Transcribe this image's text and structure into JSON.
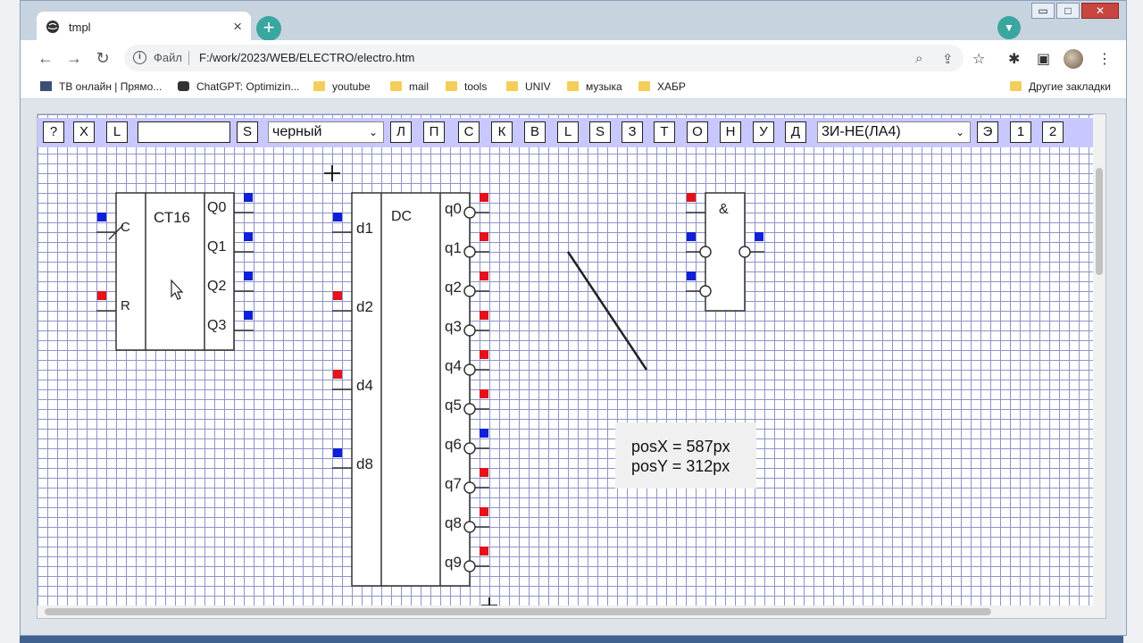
{
  "browser": {
    "tab_title": "tmpl",
    "tab_close": "×",
    "new_tab": "+",
    "omnibox_file": "Файл",
    "url": "F:/work/2023/WEB/ELECTRO/electro.htm",
    "window_controls": [
      "▭",
      "□",
      "✕"
    ]
  },
  "bookmarks": [
    {
      "label": "ТВ онлайн | Прямо...",
      "icon": "tv-icon"
    },
    {
      "label": "ChatGPT: Optimizin...",
      "icon": "chatgpt-icon"
    },
    {
      "label": "youtube",
      "icon": "folder-icon"
    },
    {
      "label": "mail",
      "icon": "folder-icon"
    },
    {
      "label": "tools",
      "icon": "folder-icon"
    },
    {
      "label": "UNIV",
      "icon": "folder-icon"
    },
    {
      "label": "музыка",
      "icon": "folder-icon"
    },
    {
      "label": "ХАБР",
      "icon": "folder-icon"
    }
  ],
  "other_bookmarks": "Другие закладки",
  "app_toolbar": {
    "btn_help": "?",
    "btn_x": "X",
    "btn_l": "L",
    "text_value": "",
    "btn_s": "S",
    "color_select": "черный",
    "tools": [
      "Л",
      "П",
      "С",
      "К",
      "В",
      "L",
      "S",
      "З",
      "Т",
      "О",
      "Н",
      "У",
      "Д"
    ],
    "element_select": "3И-НЕ(ЛА4)",
    "btn_e": "Э",
    "btn_1": "1",
    "btn_2": "2"
  },
  "counter": {
    "title": "СТ16",
    "inputs": [
      "C",
      "R"
    ],
    "outputs": [
      "Q0",
      "Q1",
      "Q2",
      "Q3"
    ]
  },
  "decoder": {
    "title": "DC",
    "inputs": [
      "d1",
      "d2",
      "d4",
      "d8"
    ],
    "outputs": [
      "q0",
      "q1",
      "q2",
      "q3",
      "q4",
      "q5",
      "q6",
      "q7",
      "q8",
      "q9"
    ]
  },
  "nand": {
    "title": "&"
  },
  "position": {
    "x_label": "posX = 587px",
    "y_label": "posY = 312px"
  },
  "colors": {
    "pin_red": "#e5111b",
    "pin_blue": "#1020d8",
    "grid": "#4f5fa8",
    "toolbar_bg": "#c8c8ff"
  }
}
